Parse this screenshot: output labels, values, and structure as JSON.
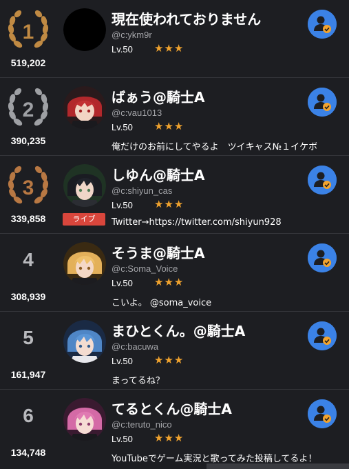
{
  "colors": {
    "background": "#1d1e22",
    "gold": "#c08a43",
    "silver": "#9ea0a4",
    "bronze": "#b87843",
    "star": "#f0a32e",
    "follow_blue": "#3b82e6",
    "check_orange": "#f2a32e",
    "live_red": "#d9463c"
  },
  "ranking": [
    {
      "rank": "1",
      "medal": "gold",
      "score": "519,202",
      "name": "現在使われておりません",
      "handle": "@c:ykm9r",
      "level": "Lv.50",
      "stars": "★★★",
      "bio": "",
      "live": "",
      "avatar": "blank-avatar"
    },
    {
      "rank": "2",
      "medal": "silver",
      "score": "390,235",
      "name": "ばぁう@騎士A",
      "handle": "@c:vau1013",
      "level": "Lv.50",
      "stars": "★★★",
      "bio": "俺だけのお前にしてやるよ　ツイキャス№１イケボ",
      "live": "",
      "avatar": "red-hair-avatar"
    },
    {
      "rank": "3",
      "medal": "bronze",
      "score": "339,858",
      "name": "しゆん@騎士A",
      "handle": "@c:shiyun_cas",
      "level": "Lv.50",
      "stars": "★★★",
      "bio": "Twitter→https://twitter.com/shiyun928",
      "live": "ライブ",
      "avatar": "dark-hair-avatar"
    },
    {
      "rank": "4",
      "medal": "",
      "score": "308,939",
      "name": "そうま@騎士A",
      "handle": "@c:Soma_Voice",
      "level": "Lv.50",
      "stars": "★★★",
      "bio": "こいよ。 @soma_voice",
      "live": "",
      "avatar": "blonde-hair-avatar"
    },
    {
      "rank": "5",
      "medal": "",
      "score": "161,947",
      "name": "まひとくん。@騎士A",
      "handle": "@c:bacuwa",
      "level": "Lv.50",
      "stars": "★★★",
      "bio": "まってるね？",
      "live": "",
      "avatar": "blue-hair-avatar"
    },
    {
      "rank": "6",
      "medal": "",
      "score": "134,748",
      "name": "てるとくん@騎士A",
      "handle": "@c:teruto_nico",
      "level": "Lv.50",
      "stars": "★★★",
      "bio": "YouTubeでゲーム実況と歌ってみた投稿してるよ！",
      "live": "",
      "avatar": "pink-hair-avatar"
    }
  ]
}
